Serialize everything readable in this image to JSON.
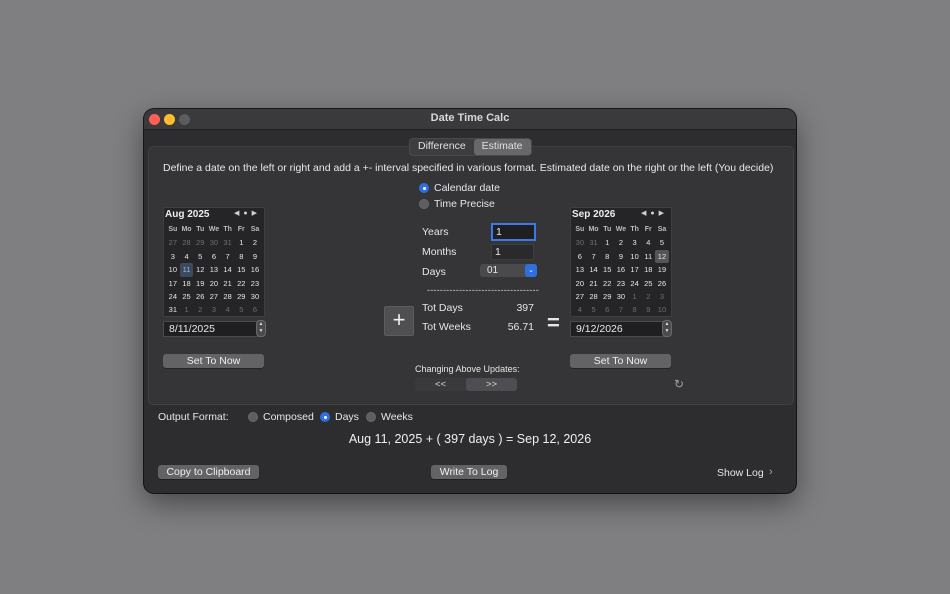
{
  "window": {
    "title": "Date Time Calc"
  },
  "tabs": [
    {
      "label": "Difference",
      "active": false
    },
    {
      "label": "Estimate",
      "active": true
    }
  ],
  "description": "Define a date on the left or right and add a +- interval specified in various format. Estimated date on the right or the left (You decide)",
  "mode_options": [
    {
      "label": "Calendar date",
      "selected": true
    },
    {
      "label": "Time Precise",
      "selected": false
    }
  ],
  "left_calendar": {
    "month_label": "Aug 2025",
    "weekdays": [
      "Su",
      "Mo",
      "Tu",
      "We",
      "Th",
      "Fr",
      "Sa"
    ],
    "days": [
      "27",
      "28",
      "29",
      "30",
      "31",
      "1",
      "2",
      "3",
      "4",
      "5",
      "6",
      "7",
      "8",
      "9",
      "10",
      "11",
      "12",
      "13",
      "14",
      "15",
      "16",
      "17",
      "18",
      "19",
      "20",
      "21",
      "22",
      "23",
      "24",
      "25",
      "26",
      "27",
      "28",
      "29",
      "30",
      "31",
      "1",
      "2",
      "3",
      "4",
      "5",
      "6"
    ],
    "dim_indices": [
      0,
      1,
      2,
      3,
      4,
      36,
      37,
      38,
      39,
      40,
      41
    ],
    "selected_index": 15,
    "date_value": "8/11/2025",
    "set_now_label": "Set To Now"
  },
  "right_calendar": {
    "month_label": "Sep 2026",
    "weekdays": [
      "Su",
      "Mo",
      "Tu",
      "We",
      "Th",
      "Fr",
      "Sa"
    ],
    "days": [
      "30",
      "31",
      "1",
      "2",
      "3",
      "4",
      "5",
      "6",
      "7",
      "8",
      "9",
      "10",
      "11",
      "12",
      "13",
      "14",
      "15",
      "16",
      "17",
      "18",
      "19",
      "20",
      "21",
      "22",
      "23",
      "24",
      "25",
      "26",
      "27",
      "28",
      "29",
      "30",
      "1",
      "2",
      "3",
      "4",
      "5",
      "6",
      "7",
      "8",
      "9",
      "10"
    ],
    "dim_indices": [
      0,
      1,
      32,
      33,
      34,
      35,
      36,
      37,
      38,
      39,
      40,
      41
    ],
    "selected_index": 13,
    "date_value": "9/12/2026",
    "set_now_label": "Set To Now"
  },
  "operator_plus": "+",
  "operator_equals": "=",
  "interval": {
    "years_label": "Years",
    "years_value": "1",
    "months_label": "Months",
    "months_value": "1",
    "days_label": "Days",
    "days_value": "01",
    "separator": "----------------------------------------------",
    "tot_days_label": "Tot Days",
    "tot_days_value": "397",
    "tot_weeks_label": "Tot Weeks",
    "tot_weeks_value": "56.71"
  },
  "updates": {
    "label": "Changing Above Updates:",
    "left_label": "<<",
    "right_label": ">>",
    "active": "right"
  },
  "output_format": {
    "label": "Output Format:",
    "options": [
      {
        "label": "Composed",
        "selected": false
      },
      {
        "label": "Days",
        "selected": true
      },
      {
        "label": "Weeks",
        "selected": false
      }
    ]
  },
  "result_text": "Aug 11, 2025 + ( 397 days ) = Sep 12, 2026",
  "footer": {
    "copy_label": "Copy to Clipboard",
    "write_log_label": "Write To Log",
    "show_log_label": "Show Log"
  },
  "colors": {
    "accent": "#2f6fe0",
    "desktop": "#7f7f82",
    "window_bg": "#2d2d2f"
  }
}
